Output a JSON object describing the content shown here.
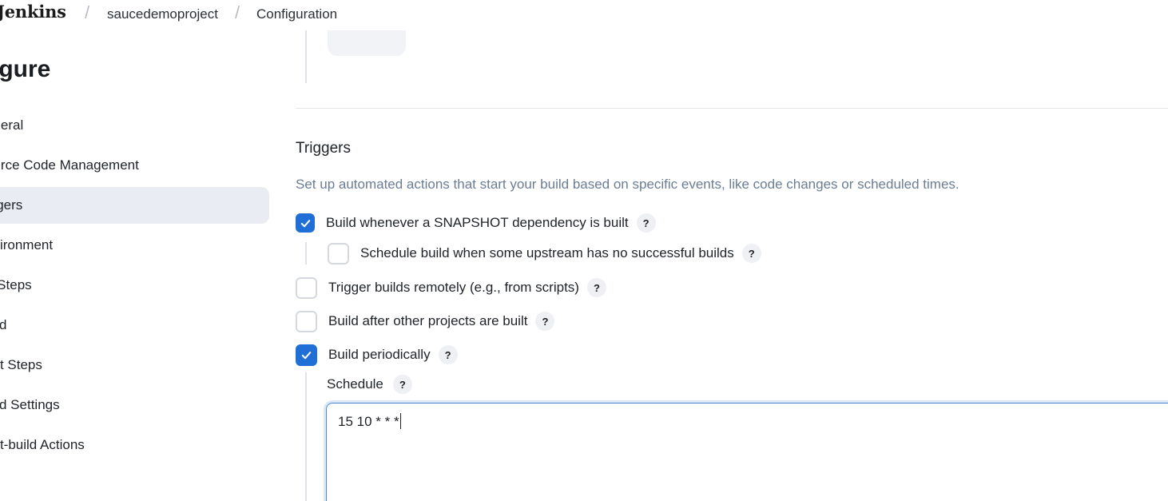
{
  "header": {
    "brand": "Jenkins",
    "breadcrumb": [
      {
        "label": "saucedemoproject"
      },
      {
        "label": "Configuration"
      }
    ]
  },
  "sidebar": {
    "title": "figure",
    "items": [
      {
        "label": "eneral"
      },
      {
        "label": "ource Code Management"
      },
      {
        "label": "iggers"
      },
      {
        "label": "nvironment"
      },
      {
        "label": "e Steps"
      },
      {
        "label": "uild"
      },
      {
        "label": "ost Steps"
      },
      {
        "label": "uild Settings"
      },
      {
        "label": "ost-build Actions"
      }
    ],
    "active_index": 2
  },
  "triggers": {
    "title": "Triggers",
    "description": "Set up automated actions that start your build based on specific events, like code changes or scheduled times.",
    "options": [
      {
        "label": "Build whenever a SNAPSHOT dependency is built",
        "checked": true
      },
      {
        "label": "Schedule build when some upstream has no successful builds",
        "checked": false
      },
      {
        "label": "Trigger builds remotely (e.g., from scripts)",
        "checked": false
      },
      {
        "label": "Build after other projects are built",
        "checked": false
      },
      {
        "label": "Build periodically",
        "checked": true
      }
    ],
    "help_glyph": "?",
    "schedule": {
      "label": "Schedule",
      "value": "15 10 * * *"
    }
  },
  "colors": {
    "accent": "#1f6fd6",
    "description": "#6a7d94",
    "active_bg": "#e9ecf2"
  },
  "icons": [
    "check-icon",
    "help-icon"
  ]
}
